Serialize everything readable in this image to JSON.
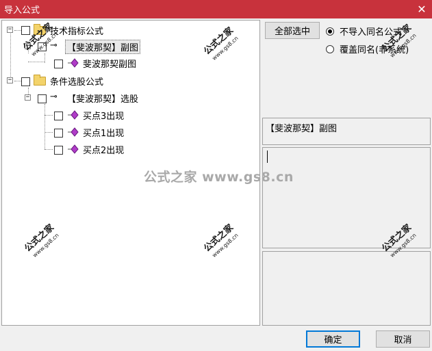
{
  "window": {
    "title": "导入公式",
    "close_glyph": "✕"
  },
  "tree": {
    "items": [
      {
        "label": "技术指标公式",
        "kind": "folder",
        "level": 0,
        "expander": "−"
      },
      {
        "label": "【斐波那契】副图",
        "kind": "key",
        "level": 1,
        "expander": "−",
        "selected": true
      },
      {
        "label": "斐波那契副图",
        "kind": "formula",
        "level": 2
      },
      {
        "label": "条件选股公式",
        "kind": "folder",
        "level": 0,
        "expander": "−"
      },
      {
        "label": "【斐波那契】选股",
        "kind": "key",
        "level": 1,
        "expander": "−"
      },
      {
        "label": "买点3出现",
        "kind": "formula",
        "level": 2
      },
      {
        "label": "买点1出现",
        "kind": "formula",
        "level": 2
      },
      {
        "label": "买点2出现",
        "kind": "formula",
        "level": 2
      }
    ]
  },
  "right": {
    "select_all_label": "全部选中",
    "radio_no_import": "不导入同名公式",
    "radio_overwrite": "覆盖同名(非系统)",
    "info_text": "【斐波那契】副图"
  },
  "buttons": {
    "ok": "确定",
    "cancel": "取消"
  },
  "watermark": {
    "center": "公式之家 www.gs8.cn",
    "stamp_main": "公式之家",
    "stamp_sub": "www.gs8.cn"
  },
  "colors": {
    "titlebar": "#c8323c",
    "default_button_border": "#0078d7"
  }
}
